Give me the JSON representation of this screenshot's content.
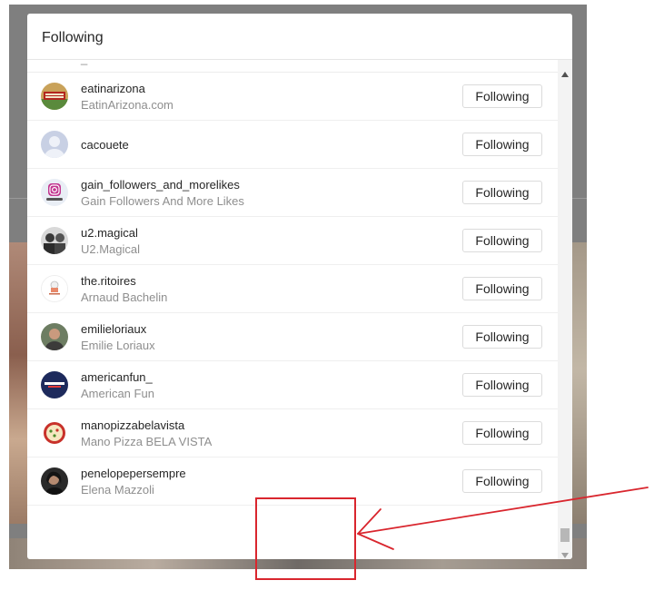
{
  "modal": {
    "title": "Following",
    "partial_row_text": "_"
  },
  "rows": [
    {
      "username": "eatinarizona",
      "fullname": "EatinArizona.com",
      "button": "Following",
      "avatar_icon": "eatinarizona-logo-icon"
    },
    {
      "username": "cacouete",
      "fullname": "",
      "button": "Following",
      "avatar_icon": "default-avatar-icon"
    },
    {
      "username": "gain_followers_and_morelikes",
      "fullname": "Gain Followers And More Likes",
      "button": "Following",
      "avatar_icon": "instagram-logo-icon"
    },
    {
      "username": "u2.magical",
      "fullname": "U2.Magical",
      "button": "Following",
      "avatar_icon": "u2-photo-icon"
    },
    {
      "username": "the.ritoires",
      "fullname": "Arnaud Bachelin",
      "button": "Following",
      "avatar_icon": "chef-logo-icon"
    },
    {
      "username": "emilieloriaux",
      "fullname": "Emilie Loriaux",
      "button": "Following",
      "avatar_icon": "profile-photo-icon"
    },
    {
      "username": "americanfun_",
      "fullname": "American Fun",
      "button": "Following",
      "avatar_icon": "american-fun-logo-icon"
    },
    {
      "username": "manopizzabelavista",
      "fullname": "Mano Pizza BELA VISTA",
      "button": "Following",
      "avatar_icon": "pizza-logo-icon"
    },
    {
      "username": "penelopepersempre",
      "fullname": "Elena Mazzoli",
      "button": "Following",
      "avatar_icon": "profile-photo-icon"
    }
  ],
  "loading": {
    "icon": "loading-spinner-icon"
  },
  "annotation": {
    "color": "#d9262e"
  },
  "colors": {
    "text": "#262626",
    "secondary_text": "#8e8e8e",
    "border": "#dbdbdb",
    "overlay": "#7f7f7f"
  }
}
